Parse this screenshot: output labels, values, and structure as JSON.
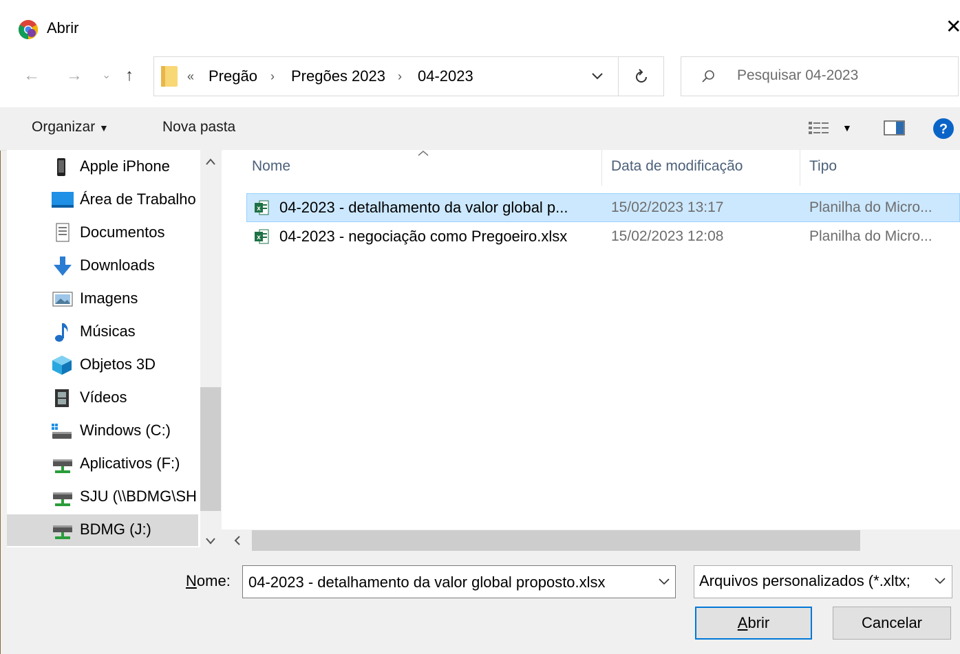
{
  "window": {
    "title": "Abrir"
  },
  "address": {
    "overflow": "«",
    "crumbs": [
      "Pregão",
      "Pregões 2023",
      "04-2023"
    ],
    "search_placeholder": "Pesquisar 04-2023"
  },
  "toolbar": {
    "organize_label": "Organizar",
    "new_folder_label": "Nova pasta"
  },
  "sidebar": {
    "items": [
      {
        "label": "Apple iPhone",
        "icon": "phone-icon"
      },
      {
        "label": "Área de Trabalho",
        "icon": "desktop-icon"
      },
      {
        "label": "Documentos",
        "icon": "documents-icon"
      },
      {
        "label": "Downloads",
        "icon": "downloads-icon"
      },
      {
        "label": "Imagens",
        "icon": "pictures-icon"
      },
      {
        "label": "Músicas",
        "icon": "music-icon"
      },
      {
        "label": "Objetos 3D",
        "icon": "objects-3d-icon"
      },
      {
        "label": "Vídeos",
        "icon": "videos-icon"
      },
      {
        "label": "Windows (C:)",
        "icon": "windows-drive-icon"
      },
      {
        "label": "Aplicativos (F:)",
        "icon": "network-drive-icon"
      },
      {
        "label": "SJU (\\\\BDMG\\SH",
        "icon": "network-drive-icon"
      },
      {
        "label": "BDMG (J:)",
        "icon": "network-drive-icon"
      }
    ],
    "selected_index": 11
  },
  "columns": [
    "Nome",
    "Data de modificação",
    "Tipo"
  ],
  "files": [
    {
      "name": "04-2023 - detalhamento da valor global p...",
      "modified": "15/02/2023 13:17",
      "type": "Planilha do Micro...",
      "selected": true
    },
    {
      "name": "04-2023 - negociação como Pregoeiro.xlsx",
      "modified": "15/02/2023 12:08",
      "type": "Planilha do Micro...",
      "selected": false
    }
  ],
  "footer": {
    "name_label_prefix": "N",
    "name_label_rest": "ome:",
    "file_name_value": "04-2023 - detalhamento da valor global proposto.xlsx",
    "filter_value": "Arquivos personalizados (*.xltx;",
    "open_label_prefix": "A",
    "open_label_rest": "brir",
    "cancel_label": "Cancelar"
  },
  "colors": {
    "accent": "#0078d7",
    "selection": "#cce8ff",
    "excel_green": "#1e7145"
  }
}
